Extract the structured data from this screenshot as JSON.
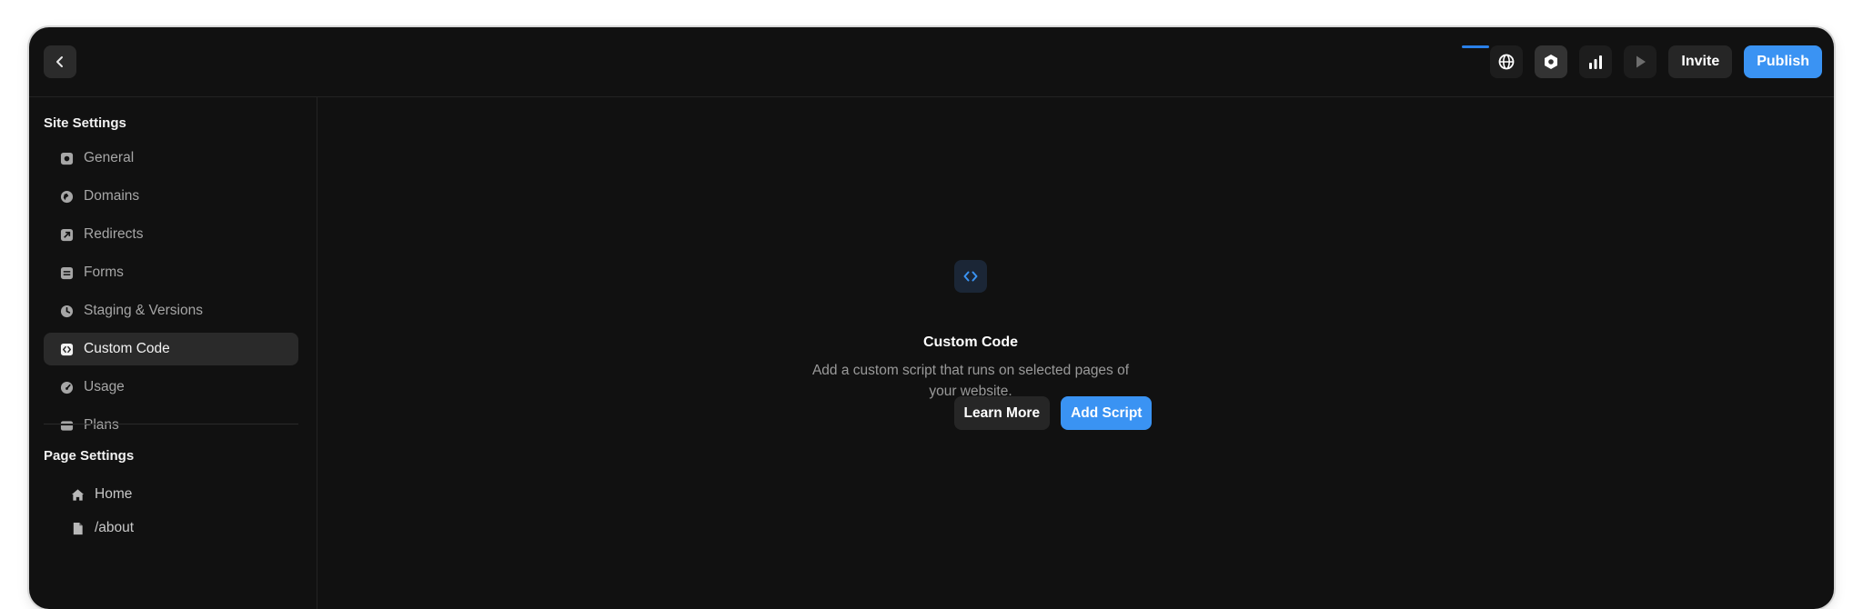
{
  "topbar": {
    "back_icon": "chevron-left-icon",
    "icons": [
      "globe-icon",
      "settings-hexagon-icon",
      "analytics-bars-icon",
      "play-icon"
    ],
    "invite_label": "Invite",
    "publish_label": "Publish"
  },
  "sidebar": {
    "site_settings_title": "Site Settings",
    "items": [
      {
        "label": "General",
        "icon": "general-icon"
      },
      {
        "label": "Domains",
        "icon": "globe-icon"
      },
      {
        "label": "Redirects",
        "icon": "redirect-arrow-icon"
      },
      {
        "label": "Forms",
        "icon": "form-icon"
      },
      {
        "label": "Staging & Versions",
        "icon": "clock-icon"
      },
      {
        "label": "Custom Code",
        "icon": "code-icon",
        "active": true
      },
      {
        "label": "Usage",
        "icon": "gauge-icon"
      },
      {
        "label": "Plans",
        "icon": "card-icon"
      }
    ],
    "page_settings_title": "Page Settings",
    "pages": [
      {
        "label": "Home",
        "icon": "home-icon"
      },
      {
        "label": "/about",
        "icon": "file-icon"
      }
    ]
  },
  "main": {
    "empty_icon": "code-brackets-icon",
    "title": "Custom Code",
    "description": "Add a custom script that runs on selected pages of your website.",
    "learn_more_label": "Learn More",
    "add_script_label": "Add Script"
  },
  "colors": {
    "accent": "#3a93f3",
    "window_bg": "#111111",
    "active_item_bg": "#2a2a2a"
  }
}
